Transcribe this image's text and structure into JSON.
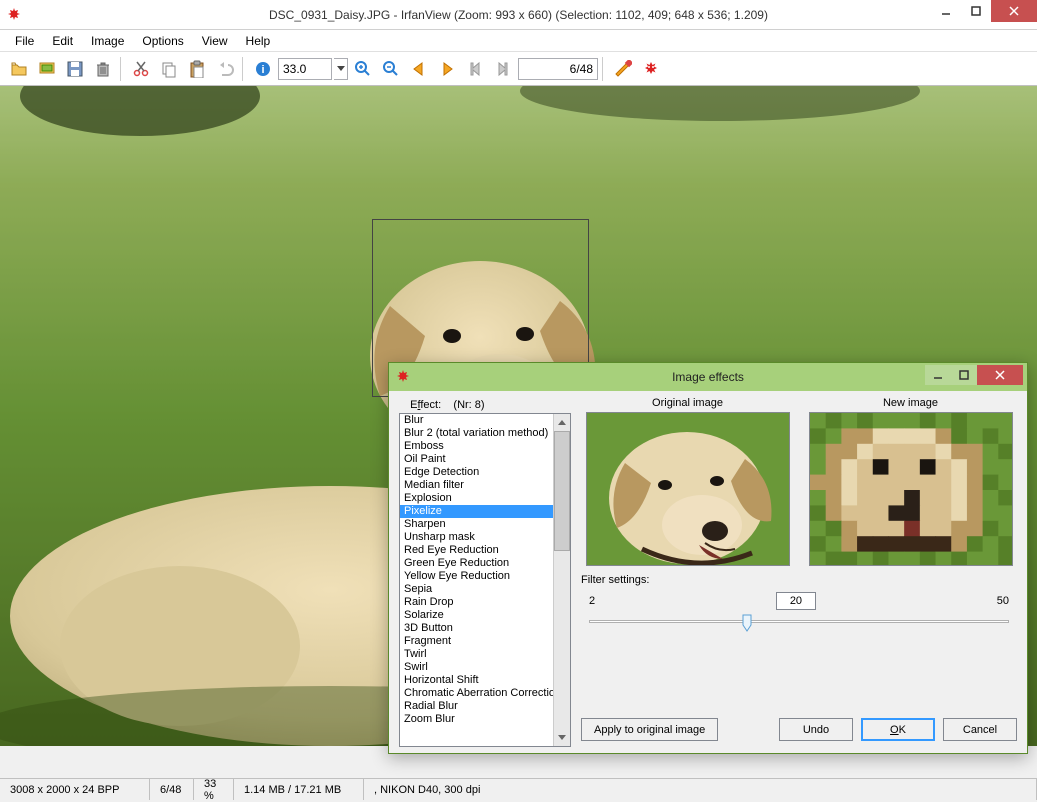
{
  "window": {
    "title": "DSC_0931_Daisy.JPG - IrfanView (Zoom: 993 x 660) (Selection: 1102, 409; 648 x 536; 1.209)"
  },
  "menu": {
    "file": "File",
    "edit": "Edit",
    "image": "Image",
    "options": "Options",
    "view": "View",
    "help": "Help"
  },
  "toolbar": {
    "zoom_value": "33.0",
    "page_value": "6/48"
  },
  "status": {
    "dimensions": "3008 x 2000 x 24 BPP",
    "page": "6/48",
    "zoom": "33 %",
    "size": "1.14 MB / 17.21 MB",
    "camera": ", NIKON D40, 300 dpi"
  },
  "dialog": {
    "title": "Image effects",
    "effect_label_pre": "E",
    "effect_label_u": "f",
    "effect_label_post": "fect:",
    "effect_nr": "(Nr: 8)",
    "original_label": "Original image",
    "new_label": "New image",
    "effects": [
      "Blur",
      "Blur 2 (total variation method)",
      "Emboss",
      "Oil Paint",
      "Edge Detection",
      "Median filter",
      "Explosion",
      "Pixelize",
      "Sharpen",
      "Unsharp mask",
      "Red Eye Reduction",
      "Green Eye Reduction",
      "Yellow Eye Reduction",
      "Sepia",
      "Rain Drop",
      "Solarize",
      "3D Button",
      "Fragment",
      "Twirl",
      "Swirl",
      "Horizontal Shift",
      "Chromatic Aberration Correction",
      "Radial Blur",
      "Zoom Blur"
    ],
    "selected_effect_index": 7,
    "filter_settings_label": "Filter settings:",
    "slider": {
      "min": "2",
      "value": "20",
      "max": "50"
    },
    "buttons": {
      "apply": "Apply to original image",
      "undo": "Undo",
      "ok_pre": "O",
      "ok_u": "K",
      "cancel": "Cancel"
    }
  }
}
